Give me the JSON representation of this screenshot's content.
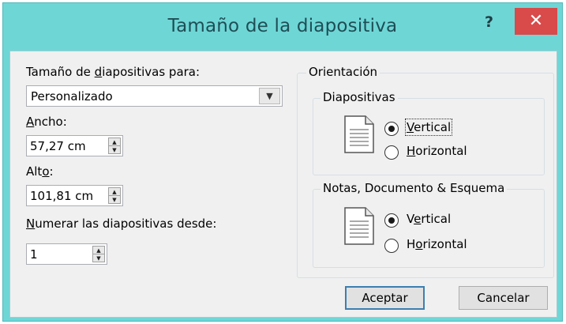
{
  "window": {
    "title": "Tamaño de la diapositiva",
    "help": "?",
    "close": "✕"
  },
  "slide_size": {
    "label_pre": "Tamaño de ",
    "label_mn": "d",
    "label_post": "iapositivas para:",
    "selected": "Personalizado"
  },
  "width": {
    "label_mn": "A",
    "label_post": "ncho:",
    "value": "57,27 cm"
  },
  "height": {
    "label_pre": "Alt",
    "label_mn": "o",
    "label_post": ":",
    "value": "101,81 cm"
  },
  "numbering": {
    "label_mn": "N",
    "label_post": "umerar las diapositivas desde:",
    "value": "1"
  },
  "orientation": {
    "title": "Orientación",
    "slides": {
      "title": "Diapositivas",
      "vertical": {
        "mn": "V",
        "rest": "ertical",
        "checked": true
      },
      "horizontal": {
        "mn": "H",
        "rest": "orizontal",
        "checked": false
      }
    },
    "notes": {
      "title": "Notas, Documento & Esquema",
      "vertical": {
        "pre": "V",
        "mn": "e",
        "rest": "rtical",
        "checked": true
      },
      "horizontal": {
        "pre": "H",
        "mn": "o",
        "rest": "rizontal",
        "checked": false
      }
    }
  },
  "buttons": {
    "ok": "Aceptar",
    "cancel": "Cancelar"
  },
  "icons": [
    "help-icon",
    "close-icon",
    "chevron-down-icon",
    "spin-up-icon",
    "spin-down-icon",
    "document-portrait-icon"
  ]
}
